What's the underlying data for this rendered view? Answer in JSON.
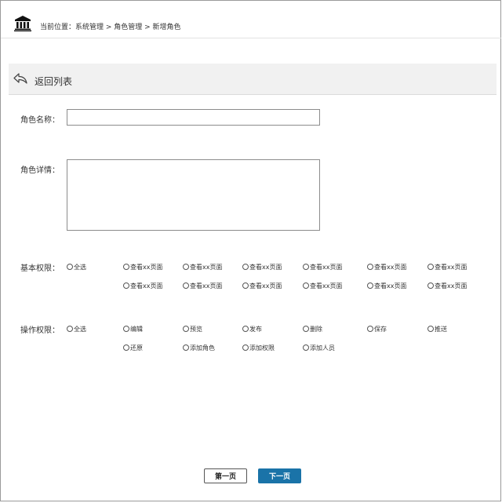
{
  "breadcrumb": {
    "prefix": "当前位置：",
    "path": "系统管理 > 角色管理 > 新增角色"
  },
  "backbar": {
    "label": "返回列表"
  },
  "form": {
    "name_label": "角色名称：",
    "name_value": "",
    "detail_label": "角色详情：",
    "detail_value": "",
    "basic_label": "基本权限：",
    "basic_options": [
      "全选",
      "查看xx页面",
      "查看xx页面",
      "查看xx页面",
      "查看xx页面",
      "查看xx页面",
      "查看xx页面",
      "查看xx页面",
      "查看xx页面",
      "查看xx页面",
      "查看xx页面",
      "查看xx页面",
      "查看xx页面"
    ],
    "op_label": "操作权限：",
    "op_options": [
      "全选",
      "编辑",
      "预览",
      "发布",
      "删除",
      "保存",
      "推送",
      "还原",
      "添加角色",
      "添加权限",
      "添加人员"
    ]
  },
  "pager": {
    "first_label": "第一页",
    "next_label": "下一页"
  },
  "colors": {
    "accent": "#1a73a8",
    "bar_bg": "#f1f1f1"
  },
  "icons": {
    "header": "bank-building-icon",
    "back": "back-arrow-icon",
    "option": "radio-circle-icon"
  }
}
